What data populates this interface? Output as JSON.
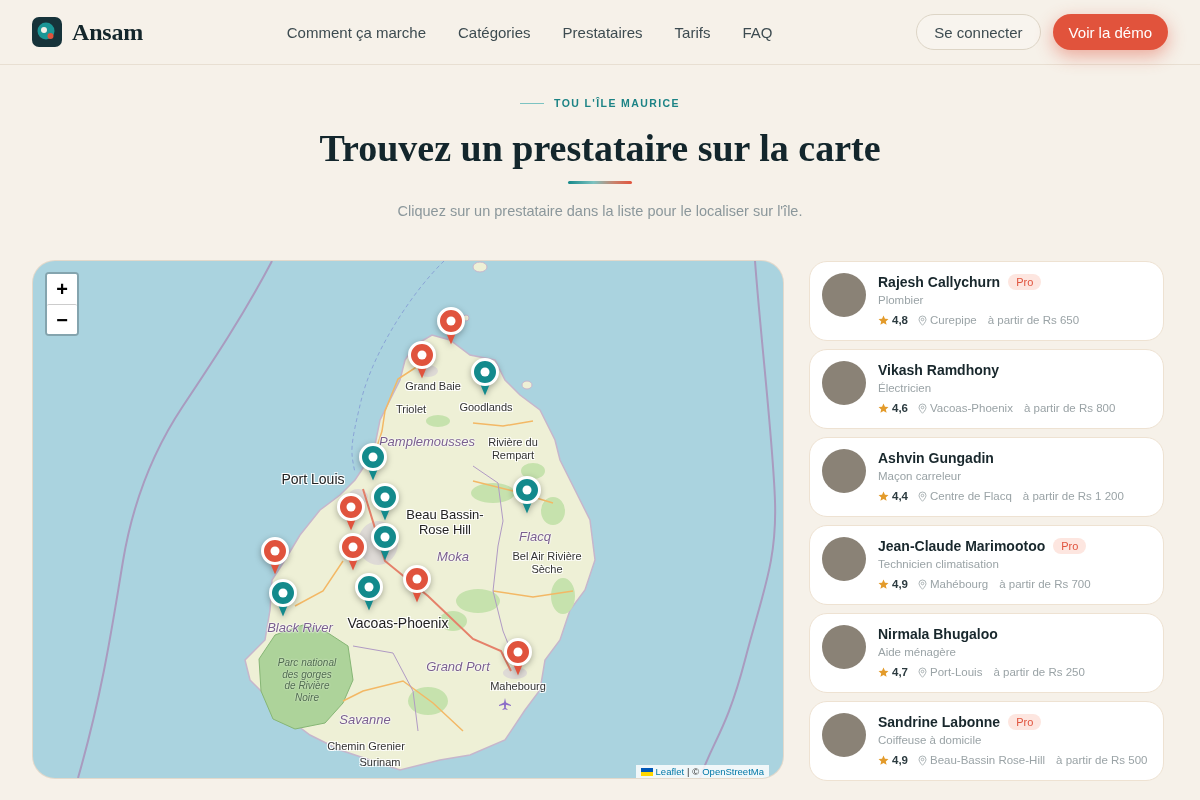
{
  "header": {
    "logo": {
      "text": "Ansam"
    },
    "nav": [
      {
        "label": "Comment ça marche"
      },
      {
        "label": "Catégories"
      },
      {
        "label": "Prestataires"
      },
      {
        "label": "Tarifs"
      },
      {
        "label": "FAQ"
      }
    ],
    "actions": [
      {
        "label": "Se connecter",
        "kind": "secondary"
      },
      {
        "label": "Voir la démo",
        "kind": "primary"
      }
    ]
  },
  "intro": {
    "eyebrow": "TOU L'ÎLE MAURICE",
    "title": "Trouvez un prestataire sur la carte",
    "subtitle": "Cliquez sur un prestataire dans la liste pour le localiser sur l'île."
  },
  "map": {
    "zoom_controls": [
      "+",
      "−"
    ],
    "labels": [
      {
        "text": "Grand Baie",
        "kind": "town"
      },
      {
        "text": "Goodlands",
        "kind": "town"
      },
      {
        "text": "Triolet",
        "kind": "town"
      },
      {
        "text": "Pamplemousses",
        "kind": "district"
      },
      {
        "text": "Rivière du Rempart",
        "kind": "town"
      },
      {
        "text": "Port Louis",
        "kind": "city"
      },
      {
        "text": "Flacq",
        "kind": "district"
      },
      {
        "text": "Bel Air Rivière Sèche",
        "kind": "town"
      },
      {
        "text": "Beau Bassin-Rose Hill",
        "kind": "city"
      },
      {
        "text": "Moka",
        "kind": "district"
      },
      {
        "text": "Vacoas-Phoenix",
        "kind": "city"
      },
      {
        "text": "Black River",
        "kind": "district"
      },
      {
        "text": "Parc national des gorges de Rivière Noire",
        "kind": "park"
      },
      {
        "text": "Grand Port",
        "kind": "district"
      },
      {
        "text": "Mahebourg",
        "kind": "town"
      },
      {
        "text": "Savanne",
        "kind": "district"
      },
      {
        "text": "Chemin Grenier",
        "kind": "town"
      },
      {
        "text": "Surinam",
        "kind": "town"
      }
    ],
    "markers": [
      {
        "color": "#e0533d"
      },
      {
        "color": "#e0533d"
      },
      {
        "color": "#138a8c"
      },
      {
        "color": "#138a8c"
      },
      {
        "color": "#138a8c"
      },
      {
        "color": "#138a8c"
      },
      {
        "color": "#e0533d"
      },
      {
        "color": "#138a8c"
      },
      {
        "color": "#e0533d"
      },
      {
        "color": "#e0533d"
      },
      {
        "color": "#138a8c"
      },
      {
        "color": "#e0533d"
      },
      {
        "color": "#138a8c"
      },
      {
        "color": "#e0533d"
      }
    ],
    "attribution": {
      "links": [
        "Leaflet",
        "OpenStreetMa"
      ],
      "separator": "| ©"
    }
  },
  "providers": [
    {
      "name": "Rajesh Callychurn",
      "badge": "Pro",
      "role": "Plombier",
      "rating": "4,8",
      "location": "Curepipe",
      "price": "à partir de Rs 650",
      "selected": false
    },
    {
      "name": "Vikash Ramdhony",
      "role": "Électricien",
      "rating": "4,6",
      "location": "Vacoas-Phoenix",
      "price": "à partir de Rs 800",
      "selected": false
    },
    {
      "name": "Ashvin Gungadin",
      "role": "Maçon carreleur",
      "rating": "4,4",
      "location": "Centre de Flacq",
      "price": "à partir de Rs 1 200",
      "selected": false
    },
    {
      "name": "Jean-Claude Marimootoo",
      "badge": "Pro",
      "role": "Technicien climatisation",
      "rating": "4,9",
      "location": "Mahébourg",
      "price": "à partir de Rs 700",
      "selected": false
    },
    {
      "name": "Nirmala Bhugaloo",
      "role": "Aide ménagère",
      "rating": "4,7",
      "location": "Port-Louis",
      "price": "à partir de Rs 250",
      "selected": false
    },
    {
      "name": "Sandrine Labonne",
      "badge": "Pro",
      "role": "Coiffeuse à domicile",
      "rating": "4,9",
      "location": "Beau-Bassin Rose-Hill",
      "price": "à partir de Rs 500",
      "selected": false
    }
  ]
}
